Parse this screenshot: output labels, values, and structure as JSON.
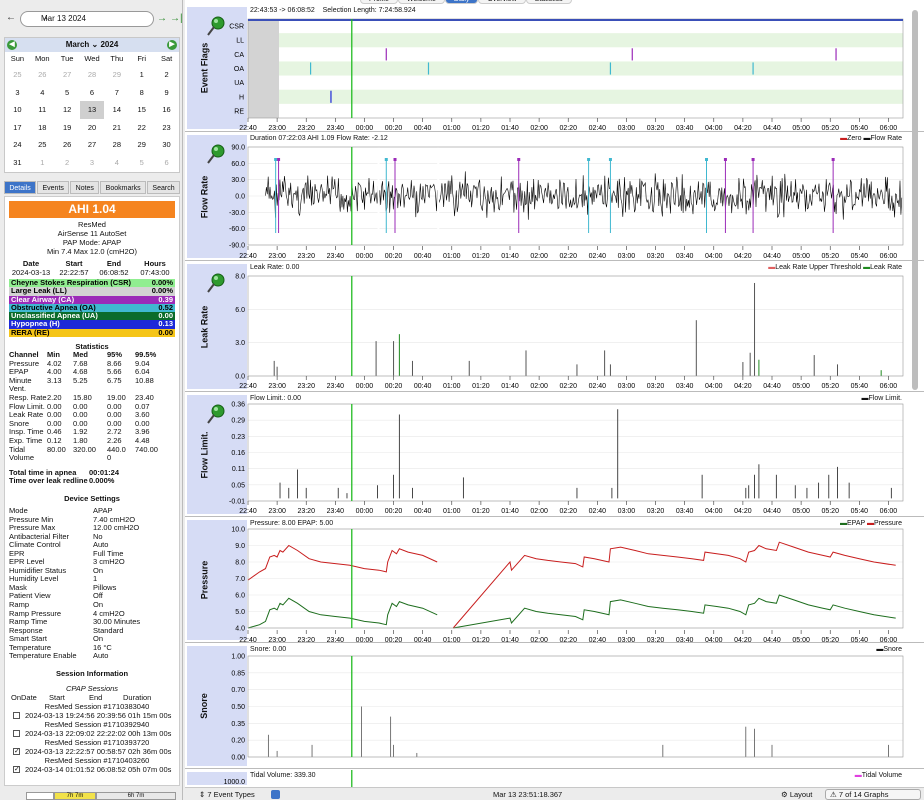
{
  "date_nav": {
    "value": "Mar 13 2024"
  },
  "calendar": {
    "month": "March",
    "year": "2024",
    "dow": [
      "Sun",
      "Mon",
      "Tue",
      "Wed",
      "Thu",
      "Fri",
      "Sat"
    ],
    "days": [
      {
        "d": "25",
        "o": true
      },
      {
        "d": "26",
        "o": true
      },
      {
        "d": "27",
        "o": true
      },
      {
        "d": "28",
        "o": true
      },
      {
        "d": "29",
        "o": true
      },
      {
        "d": "1"
      },
      {
        "d": "2"
      },
      {
        "d": "3"
      },
      {
        "d": "4"
      },
      {
        "d": "5"
      },
      {
        "d": "6"
      },
      {
        "d": "7"
      },
      {
        "d": "8"
      },
      {
        "d": "9"
      },
      {
        "d": "10"
      },
      {
        "d": "11"
      },
      {
        "d": "12"
      },
      {
        "d": "13",
        "s": true
      },
      {
        "d": "14"
      },
      {
        "d": "15"
      },
      {
        "d": "16"
      },
      {
        "d": "17"
      },
      {
        "d": "18"
      },
      {
        "d": "19"
      },
      {
        "d": "20"
      },
      {
        "d": "21"
      },
      {
        "d": "22"
      },
      {
        "d": "23"
      },
      {
        "d": "24"
      },
      {
        "d": "25"
      },
      {
        "d": "26"
      },
      {
        "d": "27"
      },
      {
        "d": "28"
      },
      {
        "d": "29"
      },
      {
        "d": "30"
      },
      {
        "d": "31"
      },
      {
        "d": "1",
        "o": true
      },
      {
        "d": "2",
        "o": true
      },
      {
        "d": "3",
        "o": true
      },
      {
        "d": "4",
        "o": true
      },
      {
        "d": "5",
        "o": true
      },
      {
        "d": "6",
        "o": true
      }
    ]
  },
  "left_tabs": [
    "Details",
    "Events",
    "Notes",
    "Bookmarks",
    "Search"
  ],
  "details": {
    "ahi": "AHI 1.04",
    "machine_lines": [
      "ResMed",
      "AirSense 11 AutoSet",
      "PAP Mode: APAP",
      "Min 7.4 Max 12.0 (cmH2O)"
    ],
    "session_header": [
      "Date",
      "Start",
      "End",
      "Hours"
    ],
    "session_values": [
      "2024-03-13",
      "22:22:57",
      "06:08:52",
      "07:43:00"
    ],
    "events": [
      {
        "name": "Cheyne Stokes Respiration (CSR)",
        "value": "0.00%",
        "bg": "#90ee90",
        "fg": "#000000"
      },
      {
        "name": "Large Leak (LL)",
        "value": "0.00%",
        "bg": "#d3d3d3",
        "fg": "#000000"
      },
      {
        "name": "Clear Airway (CA)",
        "value": "0.39",
        "bg": "#9b2bb8",
        "fg": "#ffffff"
      },
      {
        "name": "Obstructive Apnea (OA)",
        "value": "0.52",
        "bg": "#40b8d0",
        "fg": "#000000"
      },
      {
        "name": "Unclassified Apnea (UA)",
        "value": "0.00",
        "bg": "#0b6b2a",
        "fg": "#ffffff"
      },
      {
        "name": "Hypopnea (H)",
        "value": "0.13",
        "bg": "#1d28d8",
        "fg": "#ffffff"
      },
      {
        "name": "RERA (RE)",
        "value": "0.00",
        "bg": "#f5c518",
        "fg": "#000000"
      }
    ],
    "stats_title": "Statistics",
    "stats_header": [
      "Channel",
      "Min",
      "Med",
      "95%",
      "99.5%"
    ],
    "stats_rows": [
      [
        "Pressure",
        "4.02",
        "7.68",
        "8.66",
        "9.04"
      ],
      [
        "EPAP",
        "4.00",
        "4.68",
        "5.66",
        "6.04"
      ],
      [
        "Minute",
        "3.13",
        "5.25",
        "6.75",
        "10.88"
      ],
      [
        "Vent.",
        "",
        "",
        "",
        ""
      ],
      [
        "Resp. Rate",
        "2.20",
        "15.80",
        "19.00",
        "23.40"
      ],
      [
        "Flow Limit.",
        "0.00",
        "0.00",
        "0.00",
        "0.07"
      ],
      [
        "Leak Rate",
        "0.00",
        "0.00",
        "0.00",
        "3.60"
      ],
      [
        "Snore",
        "0.00",
        "0.00",
        "0.00",
        "0.00"
      ],
      [
        "Insp. Time",
        "0.46",
        "1.92",
        "2.72",
        "3.96"
      ],
      [
        "Exp. Time",
        "0.12",
        "1.80",
        "2.26",
        "4.48"
      ],
      [
        "Tidal",
        "80.00",
        "320.00",
        "440.0",
        "740.00"
      ],
      [
        "Volume",
        "",
        "",
        "0",
        ""
      ]
    ],
    "totals": [
      [
        "Total time in apnea",
        "00:01:24"
      ],
      [
        "Time over leak redline",
        "0.000%"
      ]
    ],
    "device_title": "Device Settings",
    "device_settings": [
      [
        "Mode",
        "APAP"
      ],
      [
        "Pressure Min",
        "7.40 cmH2O"
      ],
      [
        "Pressure Max",
        "12.00 cmH2O"
      ],
      [
        "Antibacterial Filter",
        "No"
      ],
      [
        "Climate Control",
        "Auto"
      ],
      [
        "EPR",
        "Full Time"
      ],
      [
        "EPR Level",
        "3 cmH2O"
      ],
      [
        "Humidifier Status",
        "On"
      ],
      [
        "Humidity Level",
        "1"
      ],
      [
        "Mask",
        "Pillows"
      ],
      [
        "Patient View",
        "Off"
      ],
      [
        "Ramp",
        "On"
      ],
      [
        "Ramp Pressure",
        "4 cmH2O"
      ],
      [
        "Ramp Time",
        "30.00 Minutes"
      ],
      [
        "Response",
        "Standard"
      ],
      [
        "Smart Start",
        "On"
      ],
      [
        "Temperature",
        "16 °C"
      ],
      [
        "Temperature Enable",
        "Auto"
      ]
    ],
    "session_info_title": "Session Information",
    "cpap_sessions_title": "CPAP Sessions",
    "sess_cols": [
      "On",
      "Date",
      "Start",
      "End",
      "Duration"
    ],
    "sessions": [
      {
        "name": "ResMed Session #1710383040",
        "checked": false,
        "text": "2024-03-13 19:24:56 20:39:56 01h 15m 00s"
      },
      {
        "name": "ResMed Session #1710392940",
        "checked": false,
        "text": "2024-03-13 22:09:02 22:22:02 00h 13m 00s"
      },
      {
        "name": "ResMed Session #1710393720",
        "checked": true,
        "text": "2024-03-13 22:22:57 00:58:57 02h 36m 00s"
      },
      {
        "name": "ResMed Session #1710403260",
        "checked": true,
        "text": "2024-03-14 01:01:52 06:08:52 05h 07m 00s"
      }
    ]
  },
  "bottom_left": {
    "b2": "7h 7m",
    "b3": "6h 7m"
  },
  "top_tabs": [
    {
      "label": "Profile",
      "active": false
    },
    {
      "label": "Welcome",
      "active": false
    },
    {
      "label": "Daily",
      "active": true
    },
    {
      "label": "Overview",
      "active": false
    },
    {
      "label": "Statistics",
      "active": false
    }
  ],
  "graphs": {
    "time_ticks": [
      "22:40",
      "23:00",
      "23:20",
      "23:40",
      "00:00",
      "00:20",
      "00:40",
      "01:00",
      "01:20",
      "01:40",
      "02:00",
      "02:20",
      "02:40",
      "03:00",
      "03:20",
      "03:40",
      "04:00",
      "04:20",
      "04:40",
      "05:00",
      "05:20",
      "05:40",
      "06:00"
    ],
    "event_flags": {
      "title": "Event Flags",
      "info_left": "22:43:53 -> 06:08:52",
      "info_mid": "Selection Length: 7:24:58.924",
      "rows": [
        "CSR",
        "LL",
        "CA",
        "OA",
        "UA",
        "H",
        "RE"
      ]
    },
    "flow_rate": {
      "title": "Flow Rate",
      "info": "Duration 07:22:03 AHI 1.09 Flow Rate: -2.12",
      "legend": [
        "Zero",
        "Flow Rate"
      ],
      "yticks": [
        "90.0",
        "60.0",
        "30.0",
        "0.0",
        "-30.0",
        "-60.0",
        "-90.0"
      ]
    },
    "leak_rate": {
      "title": "Leak Rate",
      "info": "Leak Rate: 0.00",
      "legend": [
        "Leak Rate Upper Threshold",
        "Leak Rate"
      ],
      "yticks": [
        "8.0",
        "6.0",
        "3.0",
        "0.0"
      ]
    },
    "flow_limit": {
      "title": "Flow Limit.",
      "info": "Flow Limit.: 0.00",
      "legend": [
        "Flow Limit."
      ],
      "yticks": [
        "0.36",
        "0.29",
        "0.23",
        "0.16",
        "0.11",
        "0.05",
        "-0.01"
      ]
    },
    "pressure": {
      "title": "Pressure",
      "info": "Pressure: 8.00 EPAP: 5.00",
      "legend": [
        "EPAP",
        "Pressure"
      ],
      "yticks": [
        "10.0",
        "9.0",
        "8.0",
        "7.0",
        "6.0",
        "5.0",
        "4.0"
      ]
    },
    "snore": {
      "title": "Snore",
      "info": "Snore: 0.00",
      "legend": [
        "Snore"
      ],
      "yticks": [
        "1.00",
        "0.85",
        "0.70",
        "0.50",
        "0.35",
        "0.20",
        "0.00"
      ]
    },
    "tidal": {
      "info": "Tidal Volume: 339.30",
      "legend": [
        "Tidal Volume"
      ],
      "ytop": "1000.0"
    }
  },
  "colors": {
    "cursor": "#22bb22",
    "flow": "#000000",
    "pressure": "#c81e1e",
    "epap": "#1e6e1e",
    "leak": "#555555",
    "leak_event": "#1f8a1f",
    "CA": "#9b2bb8",
    "OA": "#40b8d0",
    "H": "#1d28d8",
    "band": "#e6f5e1"
  },
  "status_bar": {
    "events": "7 Event Types",
    "time": "Mar 13 23:51:18.367",
    "layout": "Layout",
    "graphs": "7 of 14 Graphs"
  }
}
